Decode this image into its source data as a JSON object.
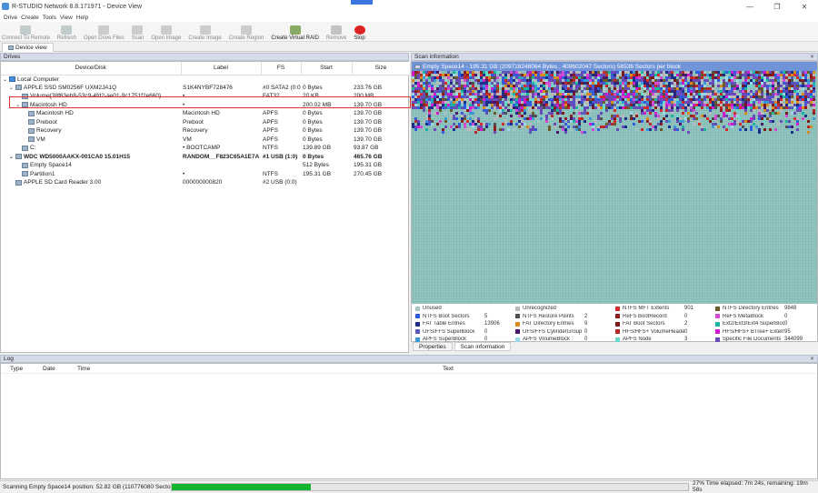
{
  "window": {
    "title": "R-STUDIO Network 8.8.171971 - Device View",
    "controls": [
      "—",
      "❐",
      "✕"
    ]
  },
  "menu": [
    "Drive",
    "Create",
    "Tools",
    "View",
    "Help"
  ],
  "toolbar": [
    {
      "label": "Connect To Remote",
      "active": false,
      "icon": "connect-icon"
    },
    {
      "label": "Refresh",
      "active": false,
      "icon": "refresh-icon"
    },
    {
      "label": "Open Drive Files",
      "active": false,
      "icon": "open-drive-files-icon"
    },
    {
      "label": "Scan",
      "active": false,
      "icon": "scan-icon"
    },
    {
      "label": "Open Image",
      "active": false,
      "icon": "open-image-icon"
    },
    {
      "label": "Create Image",
      "active": false,
      "icon": "create-image-icon"
    },
    {
      "label": "Create Region",
      "active": false,
      "icon": "create-region-icon"
    },
    {
      "label": "Create Virtual RAID",
      "active": true,
      "icon": "virtual-raid-icon"
    },
    {
      "label": "Remove",
      "active": false,
      "icon": "remove-icon"
    },
    {
      "label": "Stop",
      "active": true,
      "icon": "stop-icon"
    }
  ],
  "tabs": {
    "device_view": "Device view"
  },
  "drives": {
    "title": "Drives",
    "columns": [
      "Device/Disk",
      "Label",
      "FS",
      "Start",
      "Size"
    ],
    "rows": [
      {
        "indent": 0,
        "exp": "⌄",
        "name": "Local Computer",
        "label": "",
        "fs": "",
        "start": "",
        "size": "",
        "bold": false
      },
      {
        "indent": 1,
        "exp": "⌄",
        "name": "APPLE SSD SM0256F UXM2JA1Q",
        "label": "S1K4NYBF728476",
        "fs": "#0 SATA2 (0:0)",
        "start": "0 Bytes",
        "size": "233.76 GB",
        "bold": false
      },
      {
        "indent": 2,
        "exp": "",
        "name": "Volume{38f63eb8-53c9-4fd2-ae01-9c1751f2e660}",
        "label": "•",
        "fs": "FAT32",
        "start": "20 KB",
        "size": "200 MB",
        "bold": false
      },
      {
        "indent": 2,
        "exp": "⌄",
        "name": "Macintosh HD",
        "label": "•",
        "fs": "",
        "start": "200.02 MB",
        "size": "139.70 GB",
        "bold": false
      },
      {
        "indent": 3,
        "exp": "",
        "name": "Macintosh HD",
        "label": "Macintosh HD",
        "fs": "APFS",
        "start": "0 Bytes",
        "size": "139.70 GB",
        "bold": false
      },
      {
        "indent": 3,
        "exp": "",
        "name": "Preboot",
        "label": "Preboot",
        "fs": "APFS",
        "start": "0 Bytes",
        "size": "139.70 GB",
        "bold": false
      },
      {
        "indent": 3,
        "exp": "",
        "name": "Recovery",
        "label": "Recovery",
        "fs": "APFS",
        "start": "0 Bytes",
        "size": "139.70 GB",
        "bold": false
      },
      {
        "indent": 3,
        "exp": "",
        "name": "VM",
        "label": "VM",
        "fs": "APFS",
        "start": "0 Bytes",
        "size": "139.70 GB",
        "bold": false
      },
      {
        "indent": 2,
        "exp": "",
        "name": "C:",
        "label": "• BOOTCAMP",
        "fs": "NTFS",
        "start": "139.89 GB",
        "size": "93.87 GB",
        "bold": false
      },
      {
        "indent": 1,
        "exp": "⌄",
        "name": "WDC WD5000AAKX-001CA0 15.01H15",
        "label": "RANDOM__F823C65A1E7A",
        "fs": "#1 USB (1:0)",
        "start": "0 Bytes",
        "size": "465.76 GB",
        "bold": true
      },
      {
        "indent": 2,
        "exp": "",
        "name": "Empty Space14",
        "label": "",
        "fs": "",
        "start": "512 Bytes",
        "size": "195.31 GB",
        "bold": false
      },
      {
        "indent": 2,
        "exp": "",
        "name": "Partition1",
        "label": "•",
        "fs": "NTFS",
        "start": "195.31 GB",
        "size": "270.45 GB",
        "bold": false
      },
      {
        "indent": 1,
        "exp": "",
        "name": "APPLE SD Card Reader 3.00",
        "label": "000000000820",
        "fs": "#2 USB (0:0)",
        "start": "",
        "size": "",
        "bold": false
      }
    ]
  },
  "scan": {
    "title": "Scan information",
    "header": "Empty Space14 - 195.31 GB (209716248064 Bytes , 409602047 Sectors) 56536 Sectors per block",
    "progress": 0.27,
    "colors": {
      "bg": "#7fb7b1",
      "grid": "#aed6d1"
    },
    "legend": [
      {
        "name": "Unused",
        "count": "",
        "color": "#a5c7c3"
      },
      {
        "name": "Unrecognized",
        "count": "",
        "color": "#b9b9b9"
      },
      {
        "name": "NTFS MFT Extents",
        "count": "901",
        "color": "#d42b2b"
      },
      {
        "name": "NTFS Directory Entries",
        "count": "9848",
        "color": "#6b5a2a"
      },
      {
        "name": "NTFS Boot Sectors",
        "count": "5",
        "color": "#2d5de0"
      },
      {
        "name": "NTFS Restore Points",
        "count": "2",
        "color": "#505050"
      },
      {
        "name": "ReFS BootRecord",
        "count": "0",
        "color": "#8b1f1f"
      },
      {
        "name": "ReFS MetaBlock",
        "count": "0",
        "color": "#d24bd4"
      },
      {
        "name": "FAT Table Entries",
        "count": "13906",
        "color": "#1a2f8a"
      },
      {
        "name": "FAT Directory Entries",
        "count": "9",
        "color": "#d98b1a"
      },
      {
        "name": "FAT Boot Sectors",
        "count": "2",
        "color": "#7a1a1a"
      },
      {
        "name": "Ext2/Ext3/Ext4 SuperBlock",
        "count": "0",
        "color": "#1ab5a0"
      },
      {
        "name": "UFS/FFS SuperBlock",
        "count": "0",
        "color": "#5a5ab8"
      },
      {
        "name": "UFS/FFS CylinderGroup",
        "count": "0",
        "color": "#4a1a6a"
      },
      {
        "name": "HFS/HFS+ VolumeHeader",
        "count": "0",
        "color": "#b82a2a"
      },
      {
        "name": "HFS/HFS+ BTree+ Extents",
        "count": "95",
        "color": "#d01ad0"
      },
      {
        "name": "APFS SuperBlock",
        "count": "0",
        "color": "#3a9ad8"
      },
      {
        "name": "APFS VolumeBlock",
        "count": "0",
        "color": "#9ad8e8"
      },
      {
        "name": "APFS Node",
        "count": "3",
        "color": "#6ad8c8"
      },
      {
        "name": "Specific File Documents",
        "count": "344099",
        "color": "#6a4ab8"
      }
    ],
    "tabs": [
      "Properties",
      "Scan information"
    ]
  },
  "log": {
    "title": "Log",
    "columns": [
      "Type",
      "Date",
      "Time",
      "Text"
    ]
  },
  "status": {
    "text": "Scanning Empty Space14 position: 52.82 GB (110776080 Sectors)",
    "elapsed": "27% Time elapsed: 7m 24s, remaining: 19m 58s",
    "progress": 0.27
  }
}
